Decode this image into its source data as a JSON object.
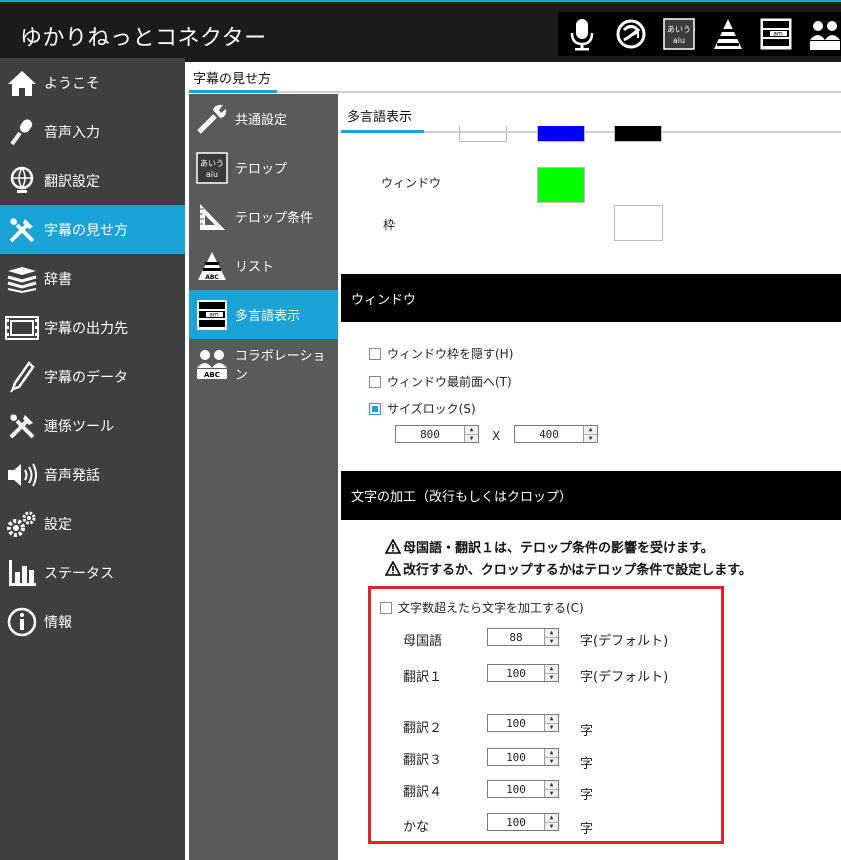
{
  "app": {
    "title": "ゆかりねっとコネクター"
  },
  "top_icons": [
    "microphone-icon",
    "translate-icon",
    "telop-icon",
    "list-icon",
    "multilang-icon",
    "collaboration-icon"
  ],
  "top_icon_labels": {
    "telop_top": "あいう",
    "telop_bottom": "aiu",
    "multilang_mid": "am"
  },
  "sidebar": {
    "items": [
      {
        "label": "ようこそ",
        "icon": "home-icon",
        "active": false
      },
      {
        "label": "音声入力",
        "icon": "microphone-icon",
        "active": false
      },
      {
        "label": "翻訳設定",
        "icon": "globe-icon",
        "active": false
      },
      {
        "label": "字幕の見せ方",
        "icon": "tools-icon",
        "active": true
      },
      {
        "label": "辞書",
        "icon": "books-icon",
        "active": false
      },
      {
        "label": "字幕の出力先",
        "icon": "filmstrip-icon",
        "active": false
      },
      {
        "label": "字幕のデータ",
        "icon": "pen-icon",
        "active": false
      },
      {
        "label": "連係ツール",
        "icon": "tools-icon",
        "active": false
      },
      {
        "label": "音声発話",
        "icon": "speaker-icon",
        "active": false
      },
      {
        "label": "設定",
        "icon": "gears-icon",
        "active": false
      },
      {
        "label": "ステータス",
        "icon": "bar-chart-icon",
        "active": false
      },
      {
        "label": "情報",
        "icon": "info-icon",
        "active": false
      }
    ]
  },
  "section": {
    "title": "字幕の見せ方"
  },
  "subnav": {
    "items": [
      {
        "label": "共通設定",
        "icon": "wrench-icon",
        "active": false
      },
      {
        "label": "テロップ",
        "icon": "telop-icon",
        "active": false
      },
      {
        "label": "テロップ条件",
        "icon": "ruler-icon",
        "active": false
      },
      {
        "label": "リスト",
        "icon": "list-icon",
        "active": false
      },
      {
        "label": "多言語表示",
        "icon": "multilang-icon",
        "active": true
      },
      {
        "label": "コラボレーション",
        "icon": "collaboration-icon",
        "active": false
      }
    ]
  },
  "subnav_icon_text": {
    "telop_top": "あいう",
    "telop_bottom": "aiu",
    "list_text": "ABC",
    "multilang_mid": "am",
    "collab_text": "ABC"
  },
  "content": {
    "tab_title": "多言語表示",
    "colors": {
      "row0": [
        "#ffffff",
        "#0000ff",
        "#000000"
      ],
      "window_color": "#00ff00",
      "frame_color": "#ffffff"
    },
    "window_label": "ウィンドウ",
    "frame_label": "枠",
    "window_section": {
      "title": "ウィンドウ",
      "hide_frame_label": "ウィンドウ枠を隠す(H)",
      "hide_frame_checked": false,
      "topmost_label": "ウィンドウ最前面へ(T)",
      "topmost_checked": false,
      "size_lock_label": "サイズロック(S)",
      "size_lock_checked": true,
      "width": "800",
      "height": "400",
      "x_label": "X"
    },
    "text_section": {
      "title": "文字の加工（改行もしくはクロップ）",
      "warning1": "母国語・翻訳１は、テロップ条件の影響を受けます。",
      "warning2": "改行するか、クロップするかはテロップ条件で設定します。",
      "process_label": "文字数超えたら文字を加工する(C)",
      "process_checked": false,
      "rows": [
        {
          "label": "母国語",
          "value": "88",
          "suffix": "字(デフォルト)"
        },
        {
          "label": "翻訳１",
          "value": "100",
          "suffix": "字(デフォルト)"
        },
        {
          "label": "翻訳２",
          "value": "100",
          "suffix": "字"
        },
        {
          "label": "翻訳３",
          "value": "100",
          "suffix": "字"
        },
        {
          "label": "翻訳４",
          "value": "100",
          "suffix": "字"
        },
        {
          "label": "かな",
          "value": "100",
          "suffix": "字"
        }
      ]
    }
  },
  "accent_color": "#1aa3d6",
  "highlight_color": "#e4202c"
}
